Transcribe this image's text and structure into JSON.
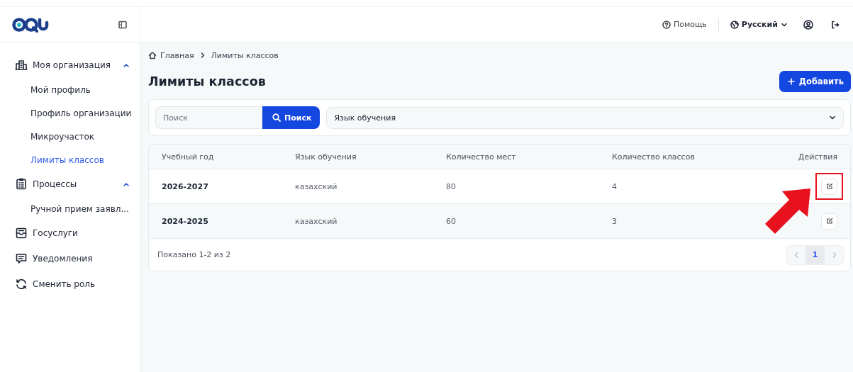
{
  "sidebar": {
    "items": [
      {
        "kind": "group",
        "label": "Моя организация",
        "expanded": true,
        "children": [
          {
            "label": "Мой профиль",
            "selected": false
          },
          {
            "label": "Профиль организации",
            "selected": false
          },
          {
            "label": "Микроучасток",
            "selected": false
          },
          {
            "label": "Лимиты классов",
            "selected": true
          }
        ]
      },
      {
        "kind": "group",
        "label": "Процессы",
        "expanded": true,
        "children": [
          {
            "label": "Ручной прием заявл...",
            "selected": false
          }
        ]
      },
      {
        "kind": "link",
        "label": "Госуслуги"
      },
      {
        "kind": "link",
        "label": "Уведомления"
      },
      {
        "kind": "link",
        "label": "Сменить роль"
      }
    ]
  },
  "header": {
    "help": "Помощь",
    "language": "Русский"
  },
  "breadcrumbs": [
    "Главная",
    "Лимиты классов"
  ],
  "page_title": "Лимиты классов",
  "add_button": "Добавить",
  "filters": {
    "search_placeholder": "Поиск",
    "search_button": "Поиск",
    "language_select": "Язык обучения"
  },
  "table": {
    "columns": [
      "Учебный год",
      "Язык обучения",
      "Количество мест",
      "Количество классов",
      "Действия"
    ],
    "rows": [
      {
        "year": "2026-2027",
        "language": "казахский",
        "seats": "80",
        "classes": "4",
        "highlighted": true
      },
      {
        "year": "2024-2025",
        "language": "казахский",
        "seats": "60",
        "classes": "3",
        "highlighted": false
      }
    ]
  },
  "pagination": {
    "summary": "Показано 1-2 из 2",
    "prev_disabled": true,
    "next_disabled": true,
    "pages": [
      {
        "label": "1",
        "selected": true
      }
    ]
  }
}
